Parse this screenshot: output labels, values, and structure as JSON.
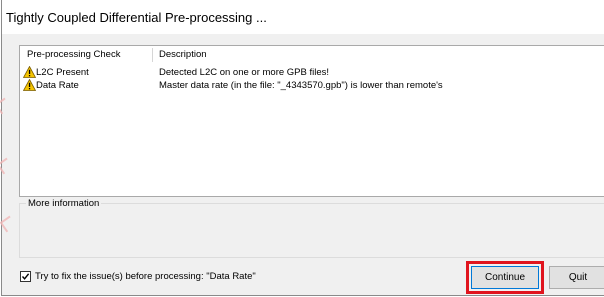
{
  "window": {
    "title": "Tightly Coupled Differential Pre-processing ..."
  },
  "checks_table": {
    "columns": [
      "Pre-processing Check",
      "Description"
    ],
    "rows": [
      {
        "icon": "warning-icon",
        "check": "L2C Present",
        "description": "Detected L2C on one or more GPB files!"
      },
      {
        "icon": "warning-icon",
        "check": "Data Rate",
        "description": "Master data rate (in the file: \"_4343570.gpb\") is lower than remote's"
      }
    ]
  },
  "more_info": {
    "label": "More information"
  },
  "fix_option": {
    "checked": true,
    "label": "Try to fix the issue(s) before processing: \"Data Rate\""
  },
  "buttons": {
    "continue_label": "Continue",
    "quit_label": "Quit"
  },
  "colors": {
    "highlight": "#e0141e",
    "warning_fill": "#f5c400",
    "focus_border": "#0078d7"
  }
}
